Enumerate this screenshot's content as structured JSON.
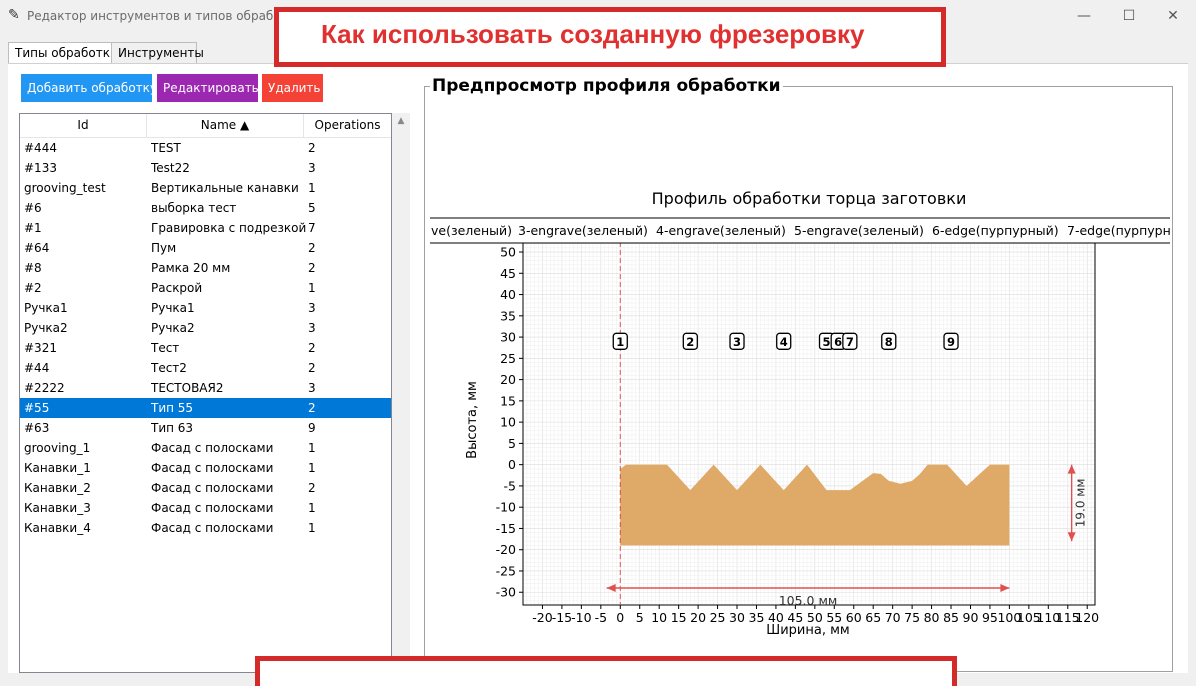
{
  "window": {
    "title": "Редактор инструментов и типов обработки",
    "controls": [
      "—",
      "☐",
      "✕"
    ]
  },
  "tabs": [
    "Типы обработки",
    "Инструменты"
  ],
  "toolbar": {
    "add_label": "Добавить обработку",
    "edit_label": "Редактировать",
    "delete_label": "Удалить",
    "add_color": "#2196f3",
    "edit_color": "#9c27b0",
    "delete_color": "#f44336"
  },
  "table": {
    "headers": [
      "Id",
      "Name ▲",
      "Operations"
    ],
    "selected_index": 13,
    "rows": [
      [
        "#444",
        "TEST",
        "2"
      ],
      [
        "#133",
        "Test22",
        "3"
      ],
      [
        "grooving_test",
        "Вертикальные канавки",
        "1"
      ],
      [
        "#6",
        "выборка тест",
        "5"
      ],
      [
        "#1",
        "Гравировка с подрезкой",
        "7"
      ],
      [
        "#64",
        "Пум",
        "2"
      ],
      [
        "#8",
        "Рамка 20 мм",
        "2"
      ],
      [
        "#2",
        "Раскрой",
        "1"
      ],
      [
        "Ручка1",
        "Ручка1",
        "3"
      ],
      [
        "Ручка2",
        "Ручка2",
        "3"
      ],
      [
        "#321",
        "Тест",
        "2"
      ],
      [
        "#44",
        "Тест2",
        "2"
      ],
      [
        "#2222",
        "ТЕСТОВАЯ2",
        "3"
      ],
      [
        "#55",
        "Тип 55",
        "2"
      ],
      [
        "#63",
        "Тип 63",
        "9"
      ],
      [
        "grooving_1",
        "Фасад с полосками",
        "1"
      ],
      [
        "Канавки_1",
        "Фасад с полосками",
        "1"
      ],
      [
        "Канавки_2",
        "Фасад с полосками",
        "2"
      ],
      [
        "Канавки_3",
        "Фасад с полосками",
        "1"
      ],
      [
        "Канавки_4",
        "Фасад с полосками",
        "1"
      ]
    ]
  },
  "preview": {
    "label": "Предпросмотр профиля обработки"
  },
  "annotation": {
    "top_text": "Как использовать созданную фрезеровку",
    "color": "#d42a2a"
  },
  "chart_data": {
    "type": "area",
    "title": "Профиль обработки торца заготовки",
    "xlabel": "Ширина, мм",
    "ylabel": "Высота, мм",
    "xlim": [
      -25,
      122
    ],
    "ylim": [
      -33,
      58
    ],
    "xticks": [
      -20,
      -15,
      -10,
      -5,
      0,
      5,
      10,
      15,
      20,
      25,
      30,
      35,
      40,
      45,
      50,
      55,
      60,
      65,
      70,
      75,
      80,
      85,
      90,
      95,
      100,
      105,
      110,
      115,
      120
    ],
    "yticks": [
      -30,
      -25,
      -20,
      -15,
      -10,
      -5,
      0,
      5,
      10,
      15,
      20,
      25,
      30,
      35,
      40,
      45,
      50,
      55
    ],
    "grid": true,
    "profile_color": "#dfa968",
    "legend_items": [
      "ve(зеленый)",
      "3-engrave(зеленый)",
      "4-engrave(зеленый)",
      "5-engrave(зеленый)",
      "6-edge(пурпурный)",
      "7-edge(пурпурн"
    ],
    "profile": [
      [
        0,
        -19
      ],
      [
        0,
        -1
      ],
      [
        1.5,
        0
      ],
      [
        12,
        0
      ],
      [
        18,
        -6
      ],
      [
        24,
        0
      ],
      [
        30,
        -6
      ],
      [
        36,
        0
      ],
      [
        42,
        -6
      ],
      [
        48,
        0
      ],
      [
        53,
        -6
      ],
      [
        59,
        -6
      ],
      [
        65,
        -2
      ],
      [
        67,
        -2.2
      ],
      [
        69,
        -3.8
      ],
      [
        72,
        -4.5
      ],
      [
        75,
        -3.8
      ],
      [
        77,
        -2.2
      ],
      [
        79,
        0
      ],
      [
        84,
        0
      ],
      [
        89,
        -5
      ],
      [
        95,
        0
      ],
      [
        100,
        0
      ],
      [
        100,
        -19
      ]
    ],
    "marker_y": 29,
    "markers": [
      {
        "label": "1",
        "x": 0
      },
      {
        "label": "2",
        "x": 18
      },
      {
        "label": "3",
        "x": 30
      },
      {
        "label": "4",
        "x": 42
      },
      {
        "label": "5",
        "x": 53
      },
      {
        "label": "6",
        "x": 56
      },
      {
        "label": "7",
        "x": 59
      },
      {
        "label": "8",
        "x": 69
      },
      {
        "label": "9",
        "x": 85
      }
    ],
    "vline_x": 0,
    "width_dimension": {
      "from": -3.5,
      "to": 100,
      "y": -29,
      "label": "105.0 мм"
    },
    "height_dimension": {
      "x": 116,
      "from": -18,
      "to": 0,
      "label": "19.0 мм"
    },
    "accent_color": "#e05050"
  }
}
